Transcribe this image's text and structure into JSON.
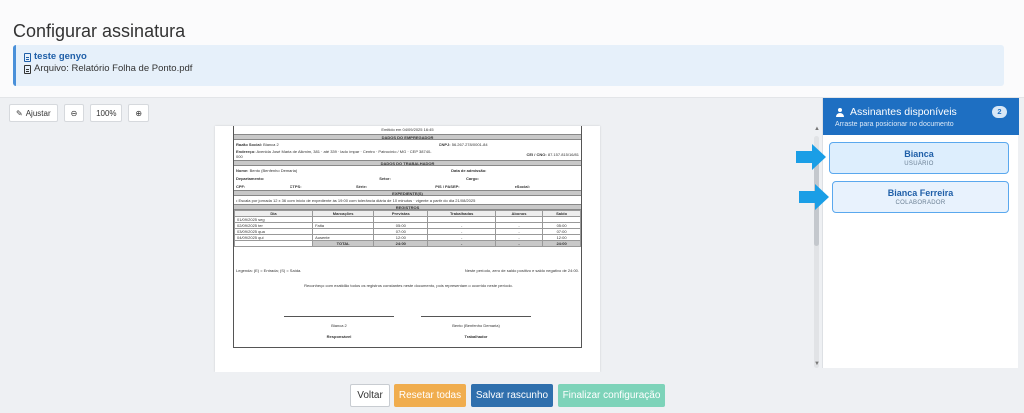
{
  "page": {
    "title": "Configurar assinatura"
  },
  "document": {
    "name": "teste genyo",
    "file": "Arquivo: Relatório Folha de Ponto.pdf"
  },
  "toolbar": {
    "fit_label": "Ajustar",
    "zoom": "100%"
  },
  "sheet": {
    "emitted": "Emitido em 04/09/2025 16:45",
    "employer_header": "DADOS DO EMPREGADOR",
    "razao": "Razão Social:",
    "razao_val": "Bianca 2",
    "cnpj": "CNPJ:",
    "cnpj_val": "56.267.278/0001-84",
    "endereco": "Endereço:",
    "endereco_val": "Avenida José Maria de Alkmim, 381 · até 339 · lado ímpar · Centro · Patrocínio / MG · CEP 38740-000",
    "cei": "CEI / CNO:",
    "cei_val": "87.157.815/16/81",
    "worker_header": "DADOS DO TRABALHADOR",
    "nome": "Nome:",
    "nome_val": "Bento (Benfenho Demaria)",
    "admissao": "Data de admissão:",
    "departamento": "Departamento:",
    "setor": "Setor:",
    "cargo": "Cargo:",
    "cpf": "CPF:",
    "ctps": "CTPS:",
    "serie": "Série:",
    "pis": "PIS / PASEP:",
    "esocial": "eSocial:",
    "exp_header": "EXPEDIENTE(S)",
    "exp_text": "Escala por jornada 12 x 36 com início de expediente às 19:00 com tolerância diária de 10 minutos · vigente a partir do dia 21/08/2025",
    "reg_header": "REGISTROS",
    "columns": [
      "Dia",
      "Marcações",
      "Previstas",
      "Trabalhadas",
      "Abonos",
      "Saldo"
    ],
    "rows": [
      [
        "01/09/2025 seg",
        "",
        "",
        "",
        "",
        ""
      ],
      [
        "02/09/2025 ter",
        "Falta",
        "05:00",
        "-",
        "-",
        "05:00"
      ],
      [
        "03/09/2025 qua",
        "",
        "07:00",
        "-",
        "-",
        "07:00"
      ],
      [
        "04/09/2025 qui",
        "Ausente",
        "12:00",
        "-",
        "-",
        "12:00"
      ]
    ],
    "total": [
      "TOTAL",
      "24:00",
      "-",
      "-",
      "24:00"
    ],
    "legend": "Legenda: (E) = Entrada; (S) = Saída.",
    "period_note": "Neste período, zero de saldo positivo e saldo negativo de 24:00.",
    "declaration": "Reconheço com exatidão todos os registros constantes neste documento, pois representam o ocorrido neste período.",
    "sig1_name": "Bianca 2",
    "sig1_role": "Responsável",
    "sig2_name": "Bento (Benfenho Demaria)",
    "sig2_role": "Trabalhador"
  },
  "panel": {
    "title": "Assinantes disponíveis",
    "subtitle": "Arraste para posicionar no documento",
    "count": "2",
    "signers": [
      {
        "name": "Bianca",
        "role": "USUÁRIO"
      },
      {
        "name": "Bianca Ferreira",
        "role": "COLABORADOR"
      }
    ]
  },
  "footer": {
    "back": "Voltar",
    "reset": "Resetar todas",
    "save": "Salvar rascunho",
    "finish": "Finalizar configuração"
  },
  "colors": {
    "accent": "#1e6fc2",
    "arrow": "#1a9ee6",
    "reset": "#f0ad4e",
    "save": "#2f6fad",
    "finish": "#7dd3b9"
  }
}
